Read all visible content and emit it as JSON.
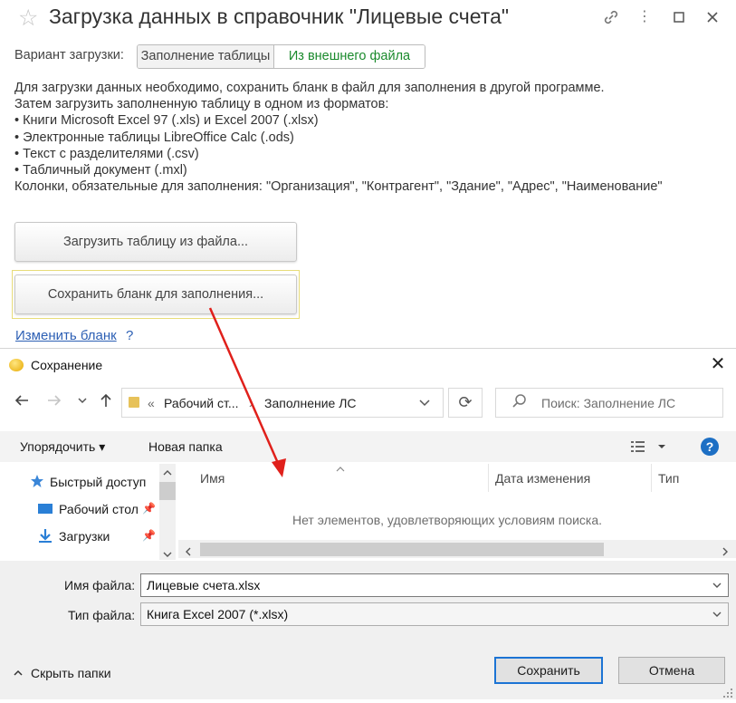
{
  "form": {
    "title": "Загрузка данных в справочник \"Лицевые счета\"",
    "variant_label": "Вариант загрузки:",
    "variant_options": [
      "Заполнение таблицы",
      "Из внешнего файла"
    ],
    "info_lines": [
      "Для загрузки данных необходимо, сохранить бланк в файл для заполнения в другой программе.",
      "Затем загрузить заполненную таблицу в одном из форматов:",
      "• Книги Microsoft Excel 97 (.xls) и Excel 2007 (.xlsx)",
      "• Электронные таблицы LibreOffice Calc (.ods)",
      "• Текст с разделителями (.csv)",
      "• Табличный документ (.mxl)",
      "Колонки, обязательные для заполнения: \"Организация\", \"Контрагент\", \"Здание\", \"Адрес\", \"Наименование\""
    ],
    "load_button": "Загрузить таблицу из файла...",
    "save_template_button": "Сохранить бланк для заполнения...",
    "change_template_link": "Изменить бланк",
    "help_mark": "?",
    "colors": {
      "active_variant": "#1a8a2c",
      "link": "#2c5fb4"
    }
  },
  "dialog": {
    "title": "Сохранение",
    "close": "✕",
    "address": {
      "sep": "«",
      "crumb1": "Рабочий ст...",
      "crumb2": "Заполнение ЛС"
    },
    "search_placeholder": "Поиск: Заполнение ЛС",
    "toolbar": {
      "organize": "Упорядочить ▾",
      "new_folder": "Новая папка"
    },
    "nav_items": [
      "Быстрый доступ",
      "Рабочий стол",
      "Загрузки"
    ],
    "columns": [
      "Имя",
      "Дата изменения",
      "Тип"
    ],
    "empty_message": "Нет элементов, удовлетворяющих условиям поиска.",
    "filename_label": "Имя файла:",
    "filename_value": "Лицевые счета.xlsx",
    "filetype_label": "Тип файла:",
    "filetype_value": "Книга Excel 2007 (*.xlsx)",
    "hide_folders": "Скрыть папки",
    "save_button": "Сохранить",
    "cancel_button": "Отмена",
    "icons": [
      "back-icon",
      "forward-icon",
      "recent-icon",
      "up-icon",
      "refresh-icon",
      "search-icon",
      "view-icon",
      "help-icon"
    ]
  },
  "annotation": {
    "arrow_color": "#e0201b"
  }
}
